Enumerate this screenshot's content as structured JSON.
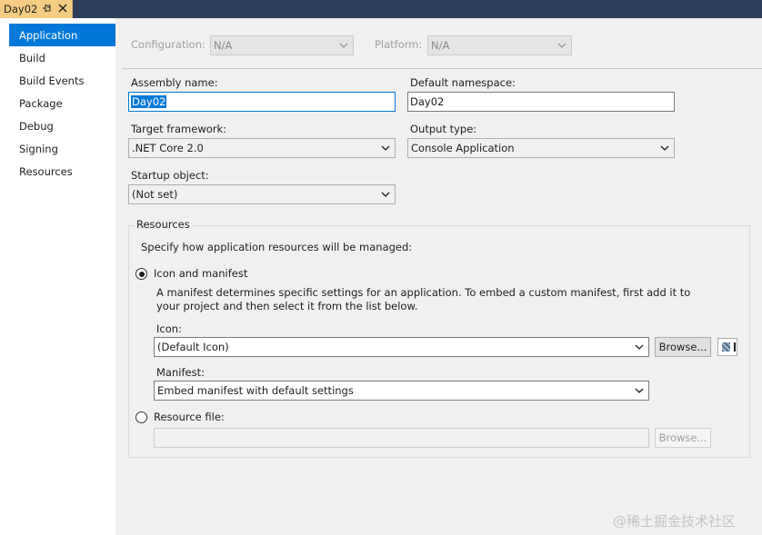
{
  "document_tab": {
    "title": "Day02"
  },
  "sidebar": {
    "items": [
      {
        "label": "Application"
      },
      {
        "label": "Build"
      },
      {
        "label": "Build Events"
      },
      {
        "label": "Package"
      },
      {
        "label": "Debug"
      },
      {
        "label": "Signing"
      },
      {
        "label": "Resources"
      }
    ]
  },
  "config": {
    "configuration_label": "Configuration:",
    "configuration_value": "N/A",
    "platform_label": "Platform:",
    "platform_value": "N/A"
  },
  "assembly": {
    "assembly_name_label": "Assembly name:",
    "assembly_name_value": "Day02",
    "default_namespace_label": "Default namespace:",
    "default_namespace_value": "Day02",
    "target_framework_label": "Target framework:",
    "target_framework_value": ".NET Core 2.0",
    "output_type_label": "Output type:",
    "output_type_value": "Console Application",
    "startup_object_label": "Startup object:",
    "startup_object_value": "(Not set)"
  },
  "resources": {
    "group_title": "Resources",
    "description": "Specify how application resources will be managed:",
    "icon_manifest_label": "Icon and manifest",
    "icon_manifest_desc_line1": "A manifest determines specific settings for an application. To embed a custom manifest, first add it to",
    "icon_manifest_desc_line2": "your project and then select it from the list below.",
    "icon_label": "Icon:",
    "icon_value": "(Default Icon)",
    "browse_label": "Browse...",
    "manifest_label": "Manifest:",
    "manifest_value": "Embed manifest with default settings",
    "resource_file_label": "Resource file:",
    "resource_file_value": "",
    "browse_disabled_label": "Browse...",
    "selected_option": "Icon and manifest"
  },
  "watermark": "@稀土掘金技术社区",
  "colors": {
    "accent": "#0078d7",
    "title_bar": "#2d3e58",
    "active_tab": "#f5cc84",
    "panel": "#f0f0f0"
  }
}
